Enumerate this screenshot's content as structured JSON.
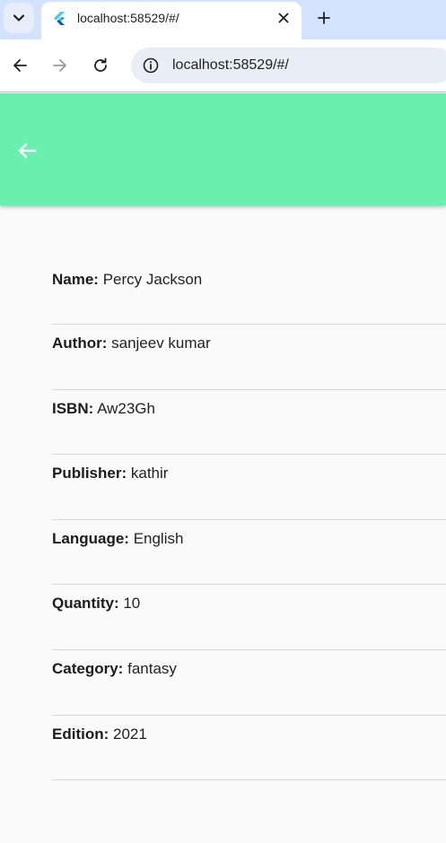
{
  "browser": {
    "tab_title": "localhost:58529/#/",
    "url": "localhost:58529/#/"
  },
  "book": {
    "fields": [
      {
        "label": "Name:",
        "value": "Percy Jackson"
      },
      {
        "label": "Author:",
        "value": "sanjeev kumar"
      },
      {
        "label": "ISBN:",
        "value": "Aw23Gh"
      },
      {
        "label": "Publisher:",
        "value": "kathir"
      },
      {
        "label": "Language:",
        "value": "English"
      },
      {
        "label": "Quantity:",
        "value": "10"
      },
      {
        "label": "Category:",
        "value": "fantasy"
      },
      {
        "label": "Edition:",
        "value": "2021"
      }
    ]
  },
  "colors": {
    "appbar": "#69f0ae",
    "tabstrip": "#d3e3fd"
  }
}
